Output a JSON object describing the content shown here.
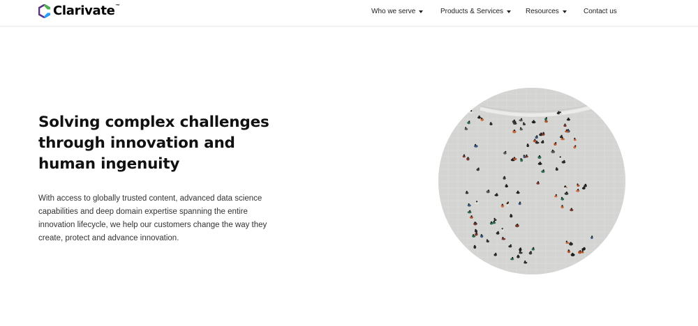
{
  "header": {
    "logo": {
      "text": "Clarivate",
      "trademark": "™"
    },
    "nav": [
      {
        "label": "Who we serve",
        "has_dropdown": true
      },
      {
        "label": "Products & Services",
        "has_dropdown": true
      },
      {
        "label": "Resources",
        "has_dropdown": true
      },
      {
        "label": "Contact us",
        "has_dropdown": false
      }
    ]
  },
  "hero": {
    "title": "Solving complex challenges through innovation and human ingenuity",
    "body": "With access to globally trusted content, advanced data science capabilities and deep domain expertise spanning the entire innovation lifecycle, we help our customers change the way they create, protect and advance innovation.",
    "image_description_icon": "crowd-aerial-photo"
  },
  "colors": {
    "text": "#111111",
    "body_text": "#333333",
    "logo_purple": "#5b2e86",
    "logo_green": "#4caf50",
    "image_floor": "#dcdcda"
  }
}
